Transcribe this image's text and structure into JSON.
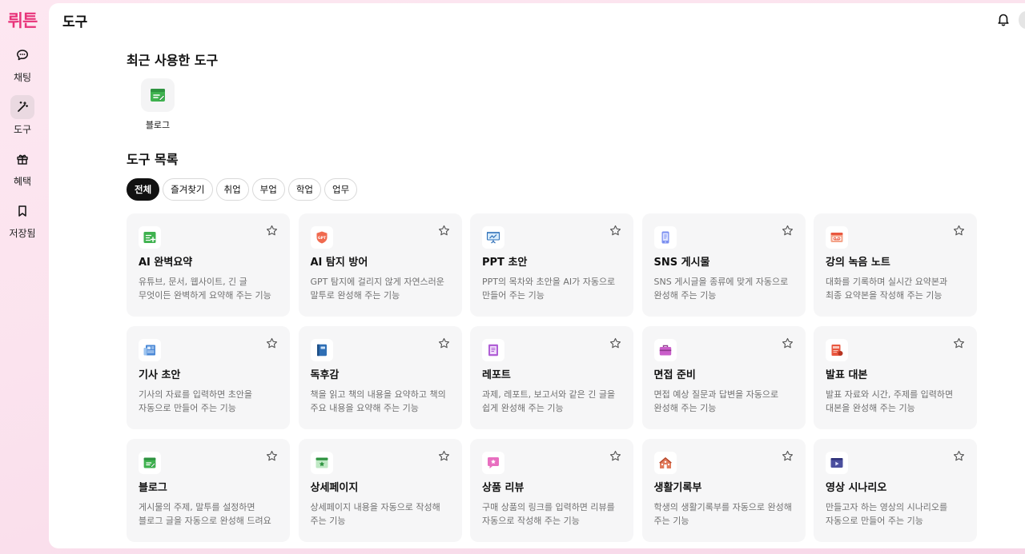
{
  "brand": {
    "logo": "뤼튼",
    "accent": "#e8337a"
  },
  "sidebar": {
    "items": [
      {
        "label": "채팅",
        "icon": "chat-icon"
      },
      {
        "label": "도구",
        "icon": "magic-wand-icon",
        "active": true
      },
      {
        "label": "혜택",
        "icon": "gift-icon"
      },
      {
        "label": "저장됨",
        "icon": "bookmark-icon"
      }
    ]
  },
  "header": {
    "title": "도구",
    "bell_icon": "bell-icon"
  },
  "recent": {
    "title": "최근 사용한 도구",
    "items": [
      {
        "label": "블로그",
        "icon": "blog-icon"
      }
    ]
  },
  "tools": {
    "title": "도구 목록",
    "filters": [
      "전체",
      "즐겨찾기",
      "취업",
      "부업",
      "학업",
      "업무"
    ],
    "active_filter": "전체",
    "cards": [
      {
        "title": "AI 완벽요약",
        "desc": "유튜브, 문서, 웹사이트, 긴 글 무엇이든 완벽하게 요약해 주는 기능",
        "icon": "summary-icon"
      },
      {
        "title": "AI 탐지 방어",
        "desc": "GPT 탐지에 걸리지 않게 자연스러운 말투로 완성해 주는 기능",
        "icon": "gpt-shield-icon"
      },
      {
        "title": "PPT 초안",
        "desc": "PPT의 목차와 초안을 AI가 자동으로 만들어 주는 기능",
        "icon": "presentation-icon"
      },
      {
        "title": "SNS 게시물",
        "desc": "SNS 게시글을 종류에 맞게 자동으로 완성해 주는 기능",
        "icon": "phone-icon"
      },
      {
        "title": "강의 녹음 노트",
        "desc": "대화를 기록하며 실시간 요약본과 최종 요약본을 작성해 주는 기능",
        "icon": "recorder-icon"
      },
      {
        "title": "기사 초안",
        "desc": "기사의 자료를 입력하면 초안을 자동으로 만들어 주는 기능",
        "icon": "newspaper-icon"
      },
      {
        "title": "독후감",
        "desc": "책을 읽고 책의 내용을 요약하고 책의 주요 내용을 요약해 주는 기능",
        "icon": "book-icon"
      },
      {
        "title": "레포트",
        "desc": "과제, 레포트, 보고서와 같은 긴 글을 쉽게 완성해 주는 기능",
        "icon": "report-icon"
      },
      {
        "title": "면접 준비",
        "desc": "면접 예상 질문과 답변을 자동으로 완성해 주는 기능",
        "icon": "briefcase-icon"
      },
      {
        "title": "발표 대본",
        "desc": "발표 자료와 시간, 주제를 입력하면 대본을 완성해 주는 기능",
        "icon": "script-icon"
      },
      {
        "title": "블로그",
        "desc": "게시물의 주제, 말투를 설정하면 블로그 글을 자동으로 완성해 드려요",
        "icon": "blog-icon"
      },
      {
        "title": "상세페이지",
        "desc": "상세페이지 내용을 자동으로 작성해 주는 기능",
        "icon": "web-page-icon"
      },
      {
        "title": "상품 리뷰",
        "desc": "구매 상품의 링크를 입력하면 리뷰를 자동으로 작성해 주는 기능",
        "icon": "review-icon"
      },
      {
        "title": "생활기록부",
        "desc": "학생의 생활기록부를 자동으로 완성해 주는 기능",
        "icon": "school-icon"
      },
      {
        "title": "영상 시나리오",
        "desc": "만들고자 하는 영상의 시나리오를 자동으로 만들어 주는 기능",
        "icon": "video-icon"
      }
    ]
  }
}
